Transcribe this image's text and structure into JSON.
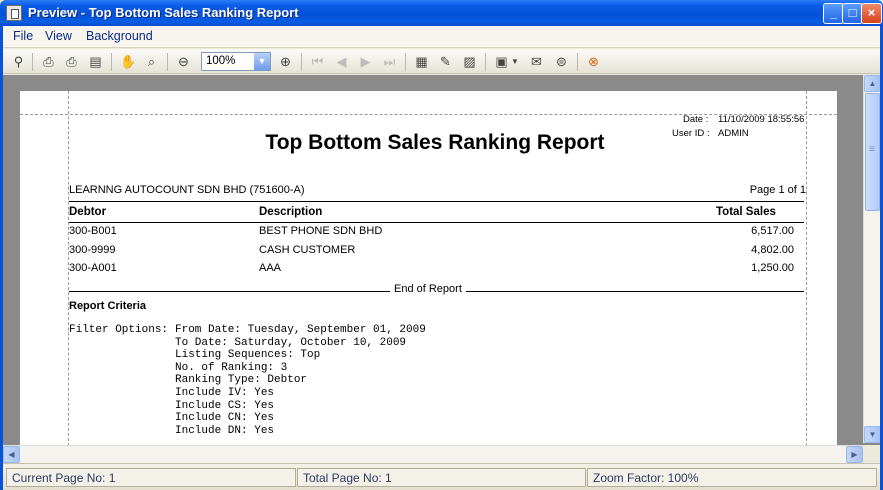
{
  "window": {
    "title": "Preview - Top Bottom Sales Ranking Report",
    "controls": {
      "minimize": "_",
      "maximize": "□",
      "close": "×"
    }
  },
  "menu": [
    {
      "label": "File"
    },
    {
      "label": "View"
    },
    {
      "label": "Background"
    }
  ],
  "toolbar": {
    "zoom_value": "100%",
    "icons": [
      "find-icon",
      "print-setup-icon",
      "print-icon",
      "page-setup-icon",
      "hand-tool-icon",
      "magnifier-icon",
      "zoom-out-icon",
      "zoom-in-icon",
      "first-page-icon",
      "previous-page-icon",
      "next-page-icon",
      "last-page-icon",
      "multiple-pages-icon",
      "color-icon",
      "watermark-icon",
      "export-icon",
      "send-email-icon",
      "open-icon",
      "close-preview-icon"
    ]
  },
  "report": {
    "date_label": "Date :",
    "date_value": "11/10/2009 18:55:56",
    "user_label": "User ID :",
    "user_value": "ADMIN",
    "title": "Top Bottom Sales Ranking Report",
    "company": "LEARNNG AUTOCOUNT SDN BHD (751600-A)",
    "page_info": "Page 1 of 1",
    "columns": {
      "debtor": "Debtor",
      "description": "Description",
      "total_sales": "Total Sales"
    },
    "rows": [
      {
        "debtor": "300-B001",
        "description": "BEST PHONE SDN BHD",
        "total_sales": "6,517.00"
      },
      {
        "debtor": "300-9999",
        "description": "CASH CUSTOMER",
        "total_sales": "4,802.00"
      },
      {
        "debtor": "300-A001",
        "description": "AAA",
        "total_sales": "1,250.00"
      }
    ],
    "end_text": "End of Report",
    "criteria_title": "Report Criteria",
    "filter_label": "Filter Options:",
    "filter_lines": [
      "From Date: Tuesday, September 01, 2009",
      "To Date: Saturday, October 10, 2009",
      "Listing Sequences: Top",
      "No. of Ranking: 3",
      "Ranking Type: Debtor",
      "Include IV: Yes",
      "Include CS: Yes",
      "Include CN: Yes",
      "Include DN: Yes"
    ]
  },
  "status": {
    "current_page": "Current Page No: 1",
    "total_page": "Total Page No: 1",
    "zoom_factor": "Zoom Factor: 100%"
  }
}
